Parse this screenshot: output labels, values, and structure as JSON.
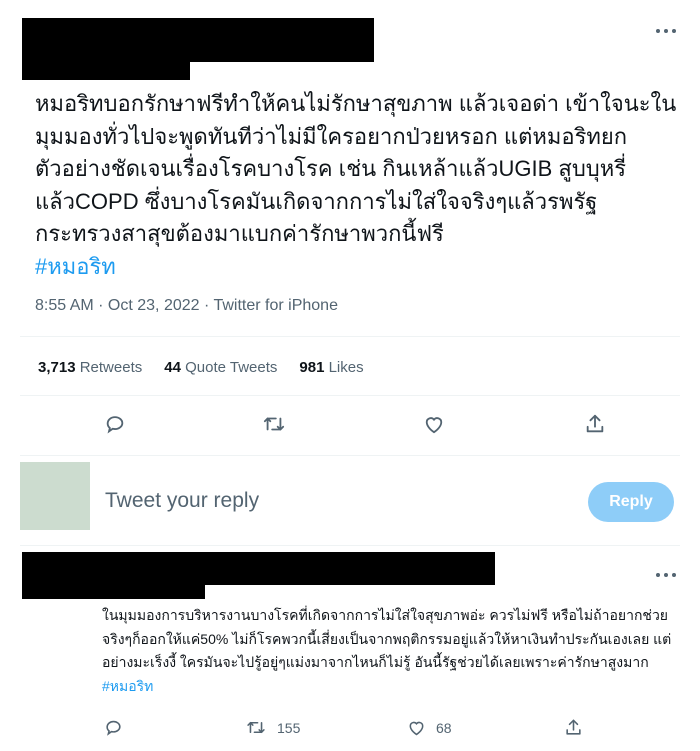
{
  "tweet": {
    "text": "หมอริทบอกรักษาฟรีทำให้คนไม่รักษาสุขภาพ แล้วเจอด่า เข้าใจนะในมุมมองทั่วไปจะพูดทันทีว่าไม่มีใครอยากป่วยหรอก แต่หมอริทยกตัวอย่างชัดเจนเรื่องโรคบางโรค เช่น กินเหล้าแล้วUGIB สูบบุหรี่แล้วCOPD ซึ่งบางโรคมันเกิดจากการไม่ใส่ใจจริงๆแล้วรพรัฐ กระทรวงสาสุขต้องมาแบกค่ารักษาพวกนี้ฟรี",
    "hashtag": "#หมอริท",
    "meta": "8:55 AM · Oct 23, 2022 · Twitter for iPhone",
    "stats": {
      "retweets_count": "3,713",
      "retweets_label": "Retweets",
      "quotes_count": "44",
      "quotes_label": "Quote Tweets",
      "likes_count": "981",
      "likes_label": "Likes"
    },
    "actions": [
      "comment-icon",
      "retweet-icon",
      "heart-icon",
      "share-icon"
    ]
  },
  "composer": {
    "placeholder": "Tweet your reply",
    "reply_label": "Reply"
  },
  "reply": {
    "text": "ในมุมมองการบริหารงานบางโรคที่เกิดจากการไม่ใส่ใจสุขภาพอ่ะ ควรไม่ฟรี หรือไม่ถ้าอยากช่วยจริงๆก็ออกให้แค่50% ไม่ก็โรคพวกนี้เสี่ยงเป็นจากพฤติกรรมอยู่แล้วให้หาเงินทำประกันเองเลย แต่อย่างมะเร็งงี้ ใครมันจะไปรู้อยู่ๆแม่งมาจากไหนก็ไม่รู้ อันนี้รัฐช่วยได้เลยเพราะค่ารักษาสูงมาก",
    "hashtag": "#หมอริท",
    "retweet_count": "155",
    "like_count": "68"
  },
  "colors": {
    "accent": "#1d9bf0",
    "reply_button": "#8ecdf8",
    "secondary_text": "#536471",
    "divider": "#eff3f4",
    "redaction": "#000000"
  }
}
